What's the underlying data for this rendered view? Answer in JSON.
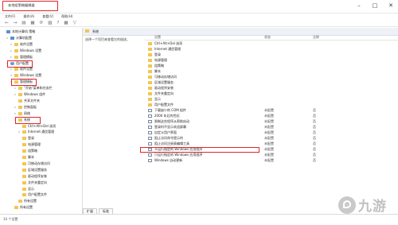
{
  "window": {
    "title": "本地组策略编辑器",
    "min": "–",
    "max": "□",
    "close": "✕"
  },
  "menu": [
    "文件(F)",
    "操作(A)",
    "查看(V)",
    "帮助(H)"
  ],
  "toolbar": [
    "←",
    "→",
    "▤",
    "▦",
    "⟳",
    "▨",
    "?",
    "▦",
    "▽"
  ],
  "tree": [
    {
      "label": "本地计算机 策略",
      "indent": 0,
      "exp": "",
      "icon": "cpu"
    },
    {
      "label": "计算机配置",
      "indent": 1,
      "exp": "∨",
      "icon": "cpu"
    },
    {
      "label": "软件设置",
      "indent": 2,
      "exp": ">",
      "icon": "folder"
    },
    {
      "label": "Windows 设置",
      "indent": 2,
      "exp": ">",
      "icon": "folder"
    },
    {
      "label": "管理模板",
      "indent": 2,
      "exp": ">",
      "icon": "folder"
    },
    {
      "label": "用户配置",
      "indent": 1,
      "exp": "∨",
      "icon": "user"
    },
    {
      "label": "软件设置",
      "indent": 2,
      "exp": ">",
      "icon": "folder"
    },
    {
      "label": "Windows 设置",
      "indent": 2,
      "exp": ">",
      "icon": "folder"
    },
    {
      "label": "管理模板",
      "indent": 2,
      "exp": "∨",
      "icon": "folder"
    },
    {
      "label": "\"开始\"菜单和任务栏",
      "indent": 3,
      "exp": ">",
      "icon": "folder"
    },
    {
      "label": "Windows 组件",
      "indent": 3,
      "exp": ">",
      "icon": "folder"
    },
    {
      "label": "共享文件夹",
      "indent": 3,
      "exp": "",
      "icon": "folder"
    },
    {
      "label": "控制面板",
      "indent": 3,
      "exp": ">",
      "icon": "folder"
    },
    {
      "label": "网络",
      "indent": 3,
      "exp": ">",
      "icon": "folder"
    },
    {
      "label": "系统",
      "indent": 3,
      "exp": "∨",
      "icon": "folder"
    },
    {
      "label": "Ctrl+Alt+Del 选项",
      "indent": 4,
      "exp": "",
      "icon": "folder"
    },
    {
      "label": "Internet 通信管理",
      "indent": 4,
      "exp": ">",
      "icon": "folder"
    },
    {
      "label": "登录",
      "indent": 4,
      "exp": "",
      "icon": "folder"
    },
    {
      "label": "电源管理",
      "indent": 4,
      "exp": "",
      "icon": "folder"
    },
    {
      "label": "组策略",
      "indent": 4,
      "exp": "",
      "icon": "folder"
    },
    {
      "label": "脚本",
      "indent": 4,
      "exp": "",
      "icon": "folder"
    },
    {
      "label": "可移动存储访问",
      "indent": 4,
      "exp": "",
      "icon": "folder"
    },
    {
      "label": "区域设置服务",
      "indent": 4,
      "exp": "",
      "icon": "folder"
    },
    {
      "label": "驱动程序安装",
      "indent": 4,
      "exp": "",
      "icon": "folder"
    },
    {
      "label": "文件夹重定向",
      "indent": 4,
      "exp": "",
      "icon": "folder"
    },
    {
      "label": "显示",
      "indent": 4,
      "exp": "",
      "icon": "folder"
    },
    {
      "label": "用户配置文件",
      "indent": 4,
      "exp": "",
      "icon": "folder"
    },
    {
      "label": "所有设置",
      "indent": 3,
      "exp": "",
      "icon": "folder"
    },
    {
      "label": "所有设置",
      "indent": 2,
      "exp": "",
      "icon": "folder"
    }
  ],
  "right": {
    "header_title": "系统",
    "description": "选择一个项目来查看它的描述。",
    "columns": {
      "setting": "设置",
      "state": "状态",
      "comment": "注释"
    },
    "rows": [
      {
        "icon": "folder",
        "name": "Ctrl+Alt+Del 选项",
        "state": "",
        "comment": ""
      },
      {
        "icon": "folder",
        "name": "Internet 通信管理",
        "state": "",
        "comment": ""
      },
      {
        "icon": "folder",
        "name": "登录",
        "state": "",
        "comment": ""
      },
      {
        "icon": "folder",
        "name": "电源管理",
        "state": "",
        "comment": ""
      },
      {
        "icon": "folder",
        "name": "组策略",
        "state": "",
        "comment": ""
      },
      {
        "icon": "folder",
        "name": "脚本",
        "state": "",
        "comment": ""
      },
      {
        "icon": "folder",
        "name": "可移动存储访问",
        "state": "",
        "comment": ""
      },
      {
        "icon": "folder",
        "name": "区域设置服务",
        "state": "",
        "comment": ""
      },
      {
        "icon": "folder",
        "name": "驱动程序安装",
        "state": "",
        "comment": ""
      },
      {
        "icon": "folder",
        "name": "文件夹重定向",
        "state": "",
        "comment": ""
      },
      {
        "icon": "folder",
        "name": "显示",
        "state": "",
        "comment": ""
      },
      {
        "icon": "folder",
        "name": "用户配置文件",
        "state": "",
        "comment": ""
      },
      {
        "icon": "setting",
        "name": "下载缺少的 COM 组件",
        "state": "未配置",
        "comment": "否"
      },
      {
        "icon": "setting",
        "name": "2000 年后的世纪",
        "state": "未配置",
        "comment": "否"
      },
      {
        "icon": "setting",
        "name": "限制这些程序从帮助启动",
        "state": "未配置",
        "comment": "否"
      },
      {
        "icon": "setting",
        "name": "登录时不显示欢迎屏幕",
        "state": "未配置",
        "comment": "否"
      },
      {
        "icon": "setting",
        "name": "自定义用户界面",
        "state": "未配置",
        "comment": "否"
      },
      {
        "icon": "setting",
        "name": "阻止访问命令提示符",
        "state": "未配置",
        "comment": "否"
      },
      {
        "icon": "setting",
        "name": "阻止访问注册表编辑工具",
        "state": "未配置",
        "comment": "否"
      },
      {
        "icon": "setting",
        "name": "不运行指定的 Windows 应用程序",
        "state": "未配置",
        "comment": "否"
      },
      {
        "icon": "setting",
        "name": "只运行指定的 Windows 应用程序",
        "state": "未配置",
        "comment": "否"
      },
      {
        "icon": "setting",
        "name": "Windows 自动更新",
        "state": "未配置",
        "comment": "否"
      }
    ]
  },
  "tabs": [
    "扩展",
    "标准"
  ],
  "status": "10 个设置",
  "watermark": "九游",
  "colors": {
    "highlight": "#e0252b",
    "folder": "#f3c552"
  }
}
